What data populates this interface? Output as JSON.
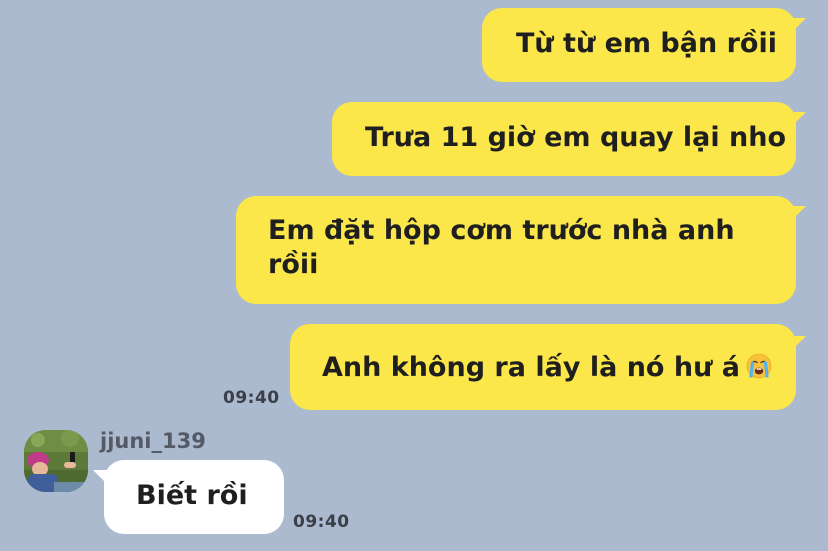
{
  "chat": {
    "outgoing": [
      {
        "text": "Từ từ em bận rồii"
      },
      {
        "text": "Trưa 11 giờ em quay lại nho"
      },
      {
        "text": "Em đặt hộp cơm trước nhà anh rồii"
      },
      {
        "text": "Anh không ra lấy là nó hư á",
        "emoji": "loudly-crying-face-icon"
      }
    ],
    "outgoing_time": "09:40",
    "incoming": {
      "username": "jjuni_139",
      "text": "Biết rồi",
      "time": "09:40"
    }
  },
  "colors": {
    "background": "#abbacf",
    "outgoing_bubble": "#fbe74a",
    "incoming_bubble": "#ffffff"
  }
}
